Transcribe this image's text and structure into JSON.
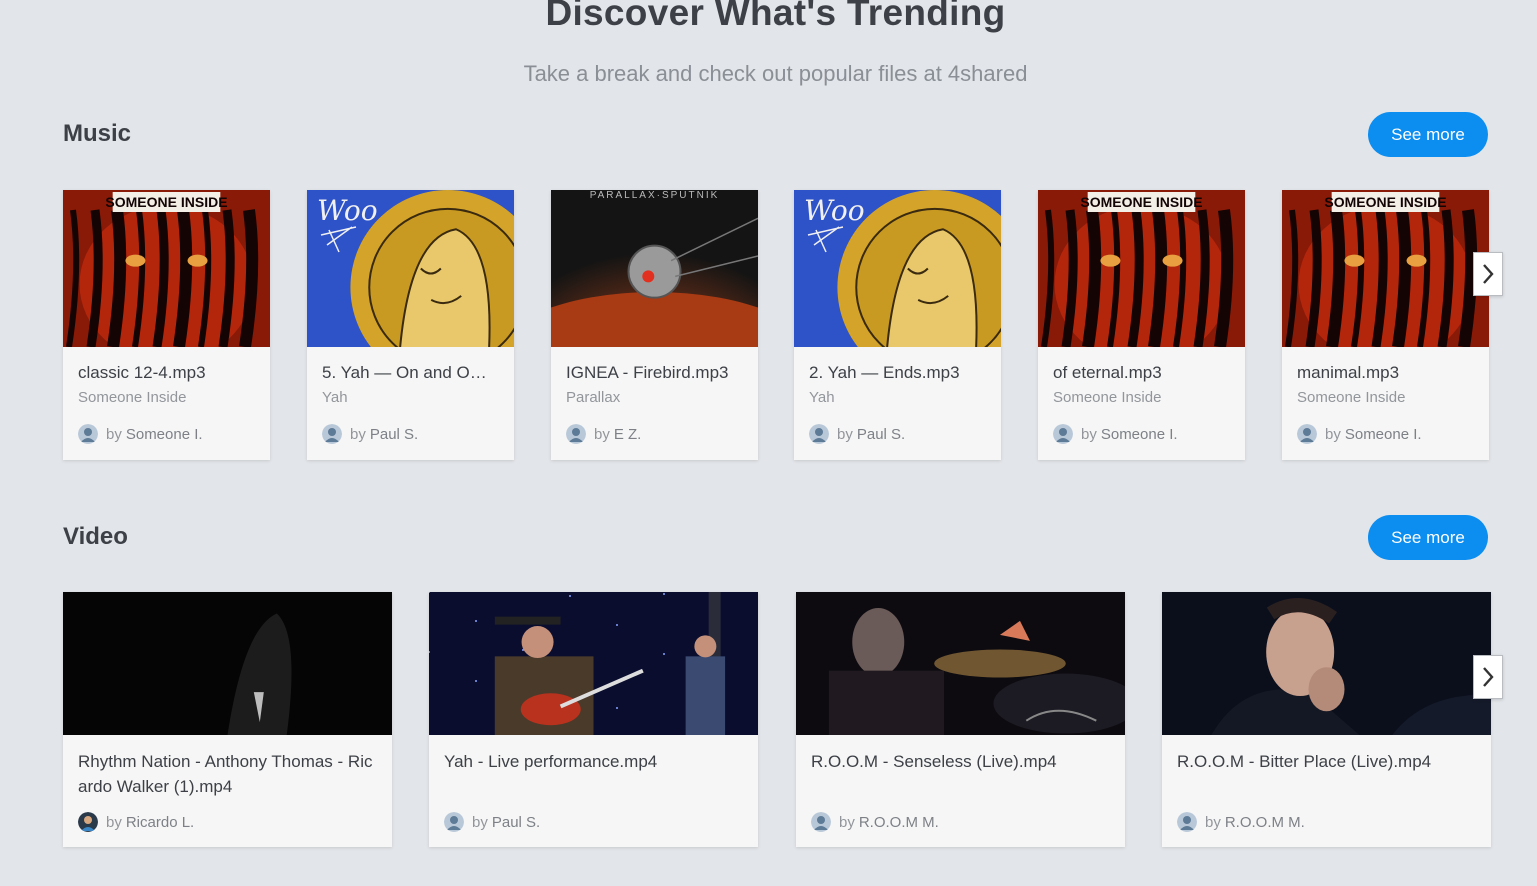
{
  "hero": {
    "title": "Discover What's Trending",
    "subtitle": "Take a break and check out popular files at 4shared"
  },
  "music": {
    "title": "Music",
    "see_more": "See more",
    "items": [
      {
        "title": "classic 12-4.mp3",
        "artist": "Someone Inside",
        "by": "by",
        "owner": "Someone I.",
        "art": "tiger",
        "art_text": "SOMEONE INSIDE"
      },
      {
        "title": "5. Yah — On and O…",
        "artist": "Yah",
        "by": "by",
        "owner": "Paul S.",
        "art": "woo",
        "art_text": "Woo"
      },
      {
        "title": "IGNEA - Firebird.mp3",
        "artist": "Parallax",
        "by": "by",
        "owner": "E Z.",
        "art": "sputnik",
        "art_text": "PARALLAX·SPUTNIK"
      },
      {
        "title": "2. Yah — Ends.mp3",
        "artist": "Yah",
        "by": "by",
        "owner": "Paul S.",
        "art": "woo",
        "art_text": "Woo"
      },
      {
        "title": "of eternal.mp3",
        "artist": "Someone Inside",
        "by": "by",
        "owner": "Someone I.",
        "art": "tiger",
        "art_text": "SOMEONE INSIDE"
      },
      {
        "title": "manimal.mp3",
        "artist": "Someone Inside",
        "by": "by",
        "owner": "Someone I.",
        "art": "tiger",
        "art_text": "SOMEONE INSIDE"
      }
    ]
  },
  "video": {
    "title": "Video",
    "see_more": "See more",
    "items": [
      {
        "title": "Rhythm Nation - Anthony Thomas - Ricardo Walker (1).mp4",
        "by": "by",
        "owner": "Ricardo L.",
        "art": "dark"
      },
      {
        "title": "Yah - Live performance.mp4",
        "by": "by",
        "owner": "Paul S.",
        "art": "guitar"
      },
      {
        "title": "R.O.O.M - Senseless (Live).mp4",
        "by": "by",
        "owner": "R.O.O.M M.",
        "art": "drums"
      },
      {
        "title": "R.O.O.M - Bitter Place (Live).mp4",
        "by": "by",
        "owner": "R.O.O.M M.",
        "art": "singer"
      }
    ]
  },
  "colors": {
    "background": "#e2e5e9",
    "accent": "#0c8df0",
    "card": "#f6f6f6"
  },
  "icons": {
    "next": "chevron-right-icon",
    "avatar": "user-avatar-icon"
  }
}
